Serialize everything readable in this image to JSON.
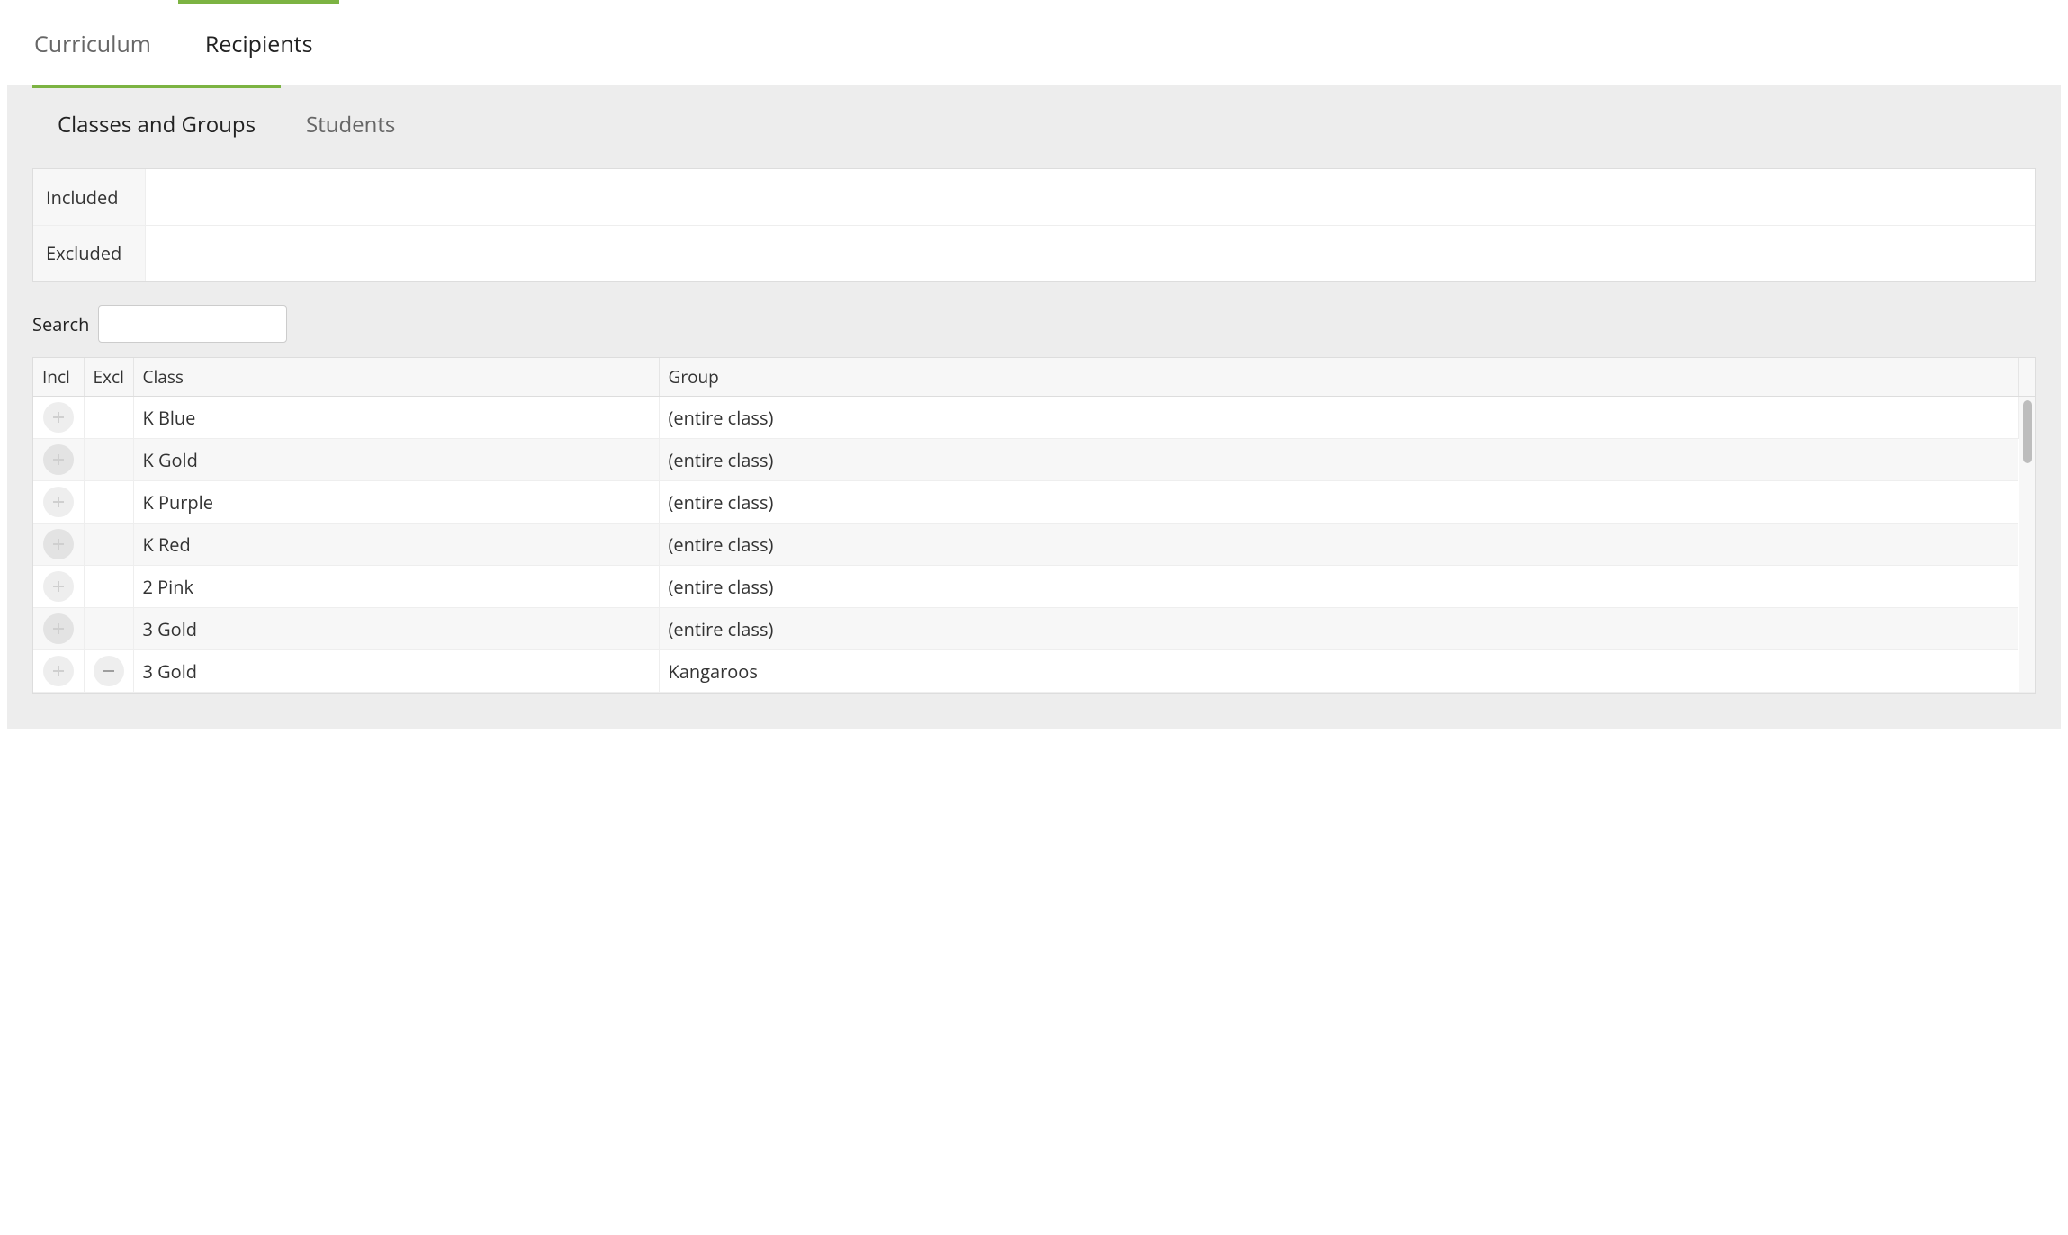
{
  "mainTabs": {
    "curriculum": "Curriculum",
    "recipients": "Recipients"
  },
  "subTabs": {
    "classesGroups": "Classes and Groups",
    "students": "Students"
  },
  "inclExcl": {
    "includedLabel": "Included",
    "excludedLabel": "Excluded",
    "includedValue": "",
    "excludedValue": ""
  },
  "search": {
    "label": "Search",
    "value": "",
    "placeholder": ""
  },
  "table": {
    "headers": {
      "incl": "Incl",
      "excl": "Excl",
      "class": "Class",
      "group": "Group"
    },
    "rows": [
      {
        "className": "K Blue",
        "group": "(entire class)",
        "hasExcl": false
      },
      {
        "className": "K Gold",
        "group": "(entire class)",
        "hasExcl": false
      },
      {
        "className": "K Purple",
        "group": "(entire class)",
        "hasExcl": false
      },
      {
        "className": "K Red",
        "group": "(entire class)",
        "hasExcl": false
      },
      {
        "className": "2 Pink",
        "group": "(entire class)",
        "hasExcl": false
      },
      {
        "className": "3 Gold",
        "group": "(entire class)",
        "hasExcl": false
      },
      {
        "className": "3 Gold",
        "group": "Kangaroos",
        "hasExcl": true
      }
    ]
  },
  "colors": {
    "accent": "#7cb342",
    "panelBg": "#ededed",
    "headerBg": "#f7f7f7",
    "border": "#ddd",
    "iconGrey": "#cfcfcf"
  }
}
